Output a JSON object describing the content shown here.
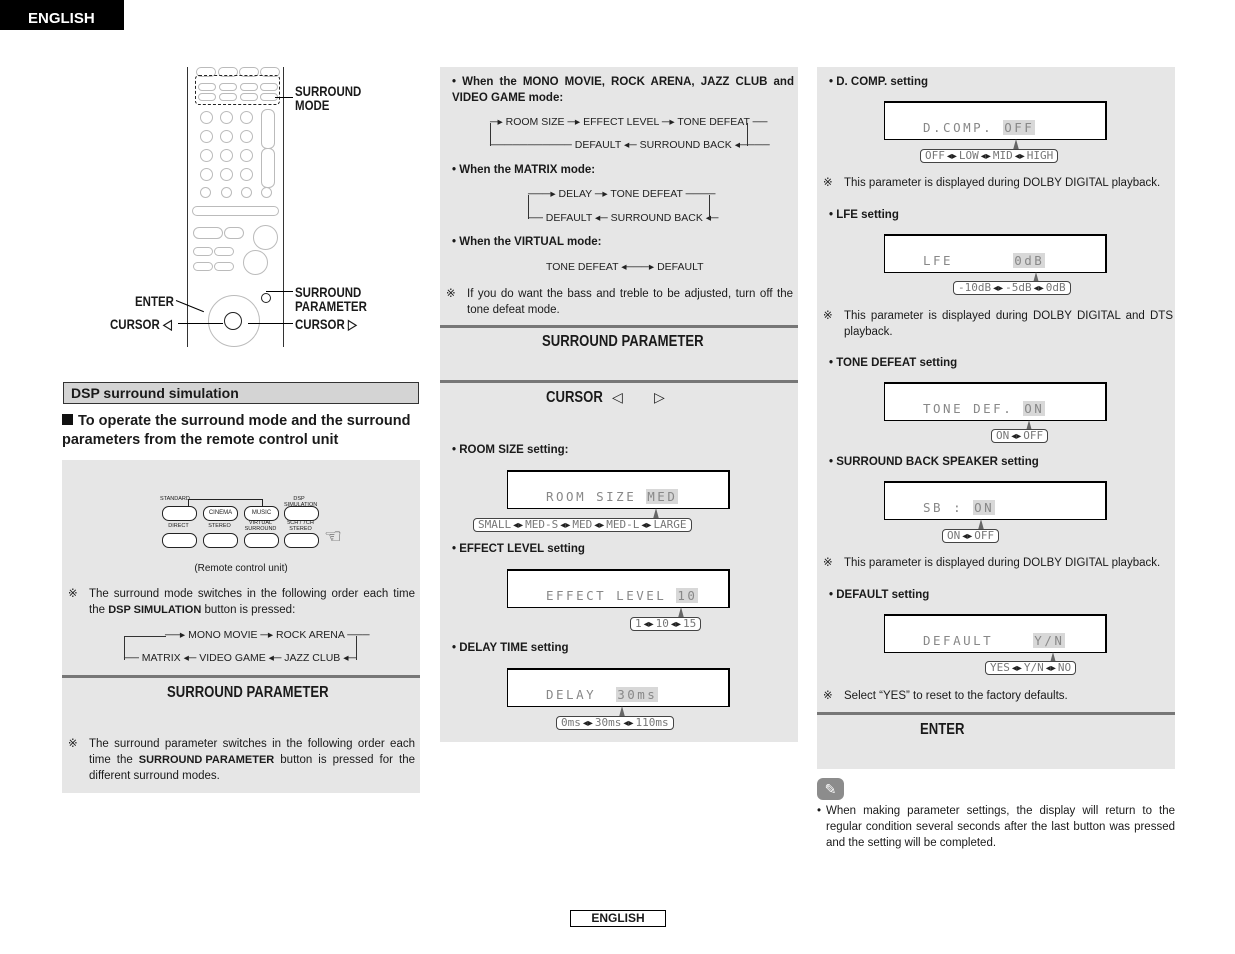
{
  "page": {
    "language_tab": "ENGLISH",
    "footer_tab": "ENGLISH"
  },
  "remote_callouts": {
    "surround_mode": [
      "SURROUND",
      "MODE"
    ],
    "surround_parameter": [
      "SURROUND",
      "PARAMETER"
    ],
    "enter": "ENTER",
    "cursor_left": "CURSOR ◁",
    "cursor_right": "CURSOR ▷"
  },
  "left_column": {
    "section_title": "DSP surround simulation",
    "operation_title": "To operate the surround mode and the surround parameters from the remote control unit",
    "remote_buttons": {
      "row1": [
        "STANDARD",
        "CINEMA",
        "MUSIC",
        "DSP SIMULATION"
      ],
      "row2": [
        "DIRECT",
        "STEREO",
        "VIRTUAL SURROUND",
        "5CH / 7CH STEREO"
      ]
    },
    "remote_caption": "(Remote control unit)",
    "note_mark": "※",
    "mode_note_pre": "The surround mode switches in the following order each time the ",
    "mode_note_bold": "DSP SIMULATION",
    "mode_note_post": " button is pressed:",
    "mode_cycle_top": [
      "MONO MOVIE",
      "ROCK ARENA"
    ],
    "mode_cycle_bottom": [
      "MATRIX",
      "VIDEO GAME",
      "JAZZ CLUB"
    ],
    "surround_parameter_header": "SURROUND  PARAMETER",
    "param_note_pre": "The surround parameter switches in the following order each time the ",
    "param_note_bold": "SURROUND PARAMETER",
    "param_note_post": " button is pressed for the different surround modes."
  },
  "middle_column": {
    "mode1_heading": "When the MONO MOVIE, ROCK ARENA, JAZZ CLUB and VIDEO GAME mode:",
    "mode1_top": [
      "ROOM SIZE",
      "EFFECT LEVEL",
      "TONE DEFEAT"
    ],
    "mode1_bottom": [
      "DEFAULT",
      "SURROUND BACK"
    ],
    "mode2_heading": "When the MATRIX mode:",
    "mode2_top": [
      "DELAY",
      "TONE DEFEAT"
    ],
    "mode2_bottom": [
      "DEFAULT",
      "SURROUND BACK"
    ],
    "mode3_heading": "When the VIRTUAL mode:",
    "mode3_items": [
      "TONE DEFEAT",
      "DEFAULT"
    ],
    "tone_note": "If you do want the bass and treble to be adjusted, turn off the tone defeat mode.",
    "surround_parameter_header": "SURROUND  PARAMETER",
    "cursor_header": "CURSOR",
    "cursor_left_icon": "◁",
    "cursor_right_icon": "▷",
    "settings": [
      {
        "heading": "ROOM SIZE setting:",
        "lcd_label": "ROOM SIZE ",
        "lcd_value": "MED",
        "options": [
          "SMALL",
          "MED-S",
          "MED",
          "MED-L",
          "LARGE"
        ]
      },
      {
        "heading": "EFFECT LEVEL setting",
        "lcd_label": "EFFECT LEVEL ",
        "lcd_value": "10",
        "options": [
          "1",
          "10",
          "15"
        ]
      },
      {
        "heading": "DELAY TIME setting",
        "lcd_label": "DELAY  ",
        "lcd_value": "30ms",
        "options": [
          "0ms",
          "30ms",
          "110ms"
        ]
      }
    ]
  },
  "right_column": {
    "settings": [
      {
        "heading": "D. COMP. setting",
        "lcd_label": "D.COMP. ",
        "lcd_value": "OFF",
        "options": [
          "OFF",
          "LOW",
          "MID",
          "HIGH"
        ],
        "note": "This parameter is displayed during DOLBY DIGITAL playback."
      },
      {
        "heading": "LFE setting",
        "lcd_label": "LFE      ",
        "lcd_value": "0dB",
        "options": [
          "-10dB",
          "-5dB",
          "0dB"
        ],
        "note": "This parameter is displayed during DOLBY DIGITAL and DTS playback."
      },
      {
        "heading": "TONE DEFEAT setting",
        "lcd_label": "TONE DEF. ",
        "lcd_value": "ON",
        "options": [
          "ON",
          "OFF"
        ]
      },
      {
        "heading": "SURROUND BACK SPEAKER setting",
        "lcd_label": "SB : ",
        "lcd_value": "ON",
        "options": [
          "ON",
          "OFF"
        ],
        "note": "This parameter is displayed during DOLBY DIGITAL playback."
      },
      {
        "heading": "DEFAULT setting",
        "lcd_label": "DEFAULT    ",
        "lcd_value": "Y/N",
        "options": [
          "YES",
          "Y/N",
          "NO"
        ],
        "note": "Select “YES” to reset to the factory defaults."
      }
    ],
    "enter_header": "ENTER",
    "pencil_icon": "✎",
    "tip": "When making parameter settings, the display will return to the regular condition several seconds after the last button was pressed and the setting will be completed."
  }
}
